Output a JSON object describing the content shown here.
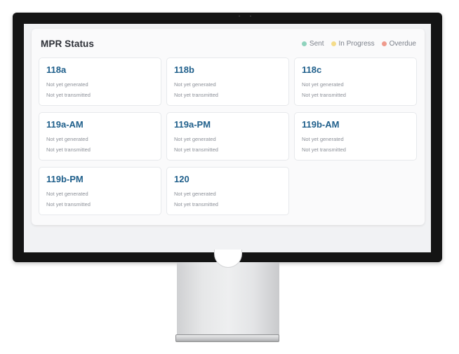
{
  "panel": {
    "title": "MPR Status",
    "legend": [
      {
        "label": "Sent",
        "color": "#8fd3bd"
      },
      {
        "label": "In Progress",
        "color": "#f5dc8a"
      },
      {
        "label": "Overdue",
        "color": "#ef9a8c"
      }
    ]
  },
  "mprs": [
    {
      "name": "118a",
      "generated": "Not yet generated",
      "transmitted": "Not yet transmitted"
    },
    {
      "name": "118b",
      "generated": "Not yet generated",
      "transmitted": "Not yet transmitted"
    },
    {
      "name": "118c",
      "generated": "Not yet generated",
      "transmitted": "Not yet transmitted"
    },
    {
      "name": "119a-AM",
      "generated": "Not yet generated",
      "transmitted": "Not yet transmitted"
    },
    {
      "name": "119a-PM",
      "generated": "Not yet generated",
      "transmitted": "Not yet transmitted"
    },
    {
      "name": "119b-AM",
      "generated": "Not yet generated",
      "transmitted": "Not yet transmitted"
    },
    {
      "name": "119b-PM",
      "generated": "Not yet generated",
      "transmitted": "Not yet transmitted"
    },
    {
      "name": "120",
      "generated": "Not yet generated",
      "transmitted": "Not yet transmitted"
    }
  ]
}
